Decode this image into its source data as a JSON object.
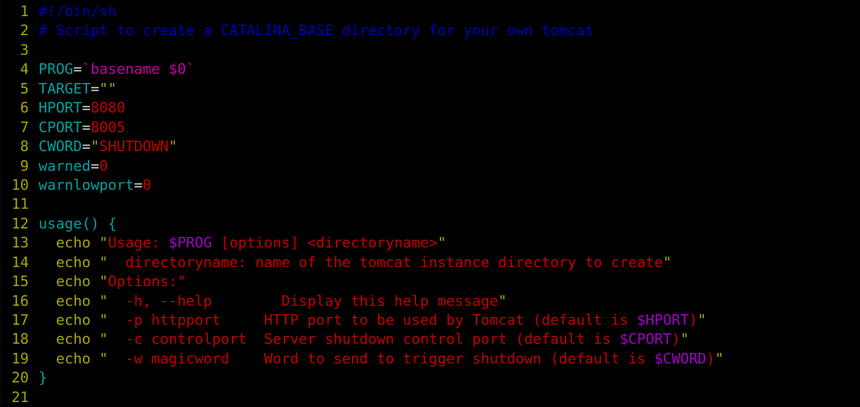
{
  "editor": {
    "title": "Shell Script Viewer",
    "language": "sh",
    "background_color": "#000000",
    "gutter_color": "#a6a600",
    "total_lines": 21,
    "colors": {
      "comment": "#0000b3",
      "variable": "#00a0a0",
      "operator": "#d8d8d8",
      "number": "#c00000",
      "string": "#c00000",
      "quote": "#a6a600",
      "keyword": "#a6a600",
      "substitution": "#a000c8",
      "backtick": "#c000a0",
      "brace": "#00a0a0"
    }
  },
  "lines": [
    {
      "num": "1",
      "tokens": [
        {
          "t": "#!/bin/sh",
          "c": "tok-comment"
        }
      ]
    },
    {
      "num": "2",
      "tokens": [
        {
          "t": "# Script to create a CATALINA_BASE directory for your own tomcat",
          "c": "tok-comment"
        }
      ]
    },
    {
      "num": "3",
      "tokens": []
    },
    {
      "num": "4",
      "tokens": [
        {
          "t": "PROG",
          "c": "tok-var"
        },
        {
          "t": "=",
          "c": "tok-op"
        },
        {
          "t": "`basename $0`",
          "c": "tok-backtick"
        }
      ]
    },
    {
      "num": "5",
      "tokens": [
        {
          "t": "TARGET",
          "c": "tok-var"
        },
        {
          "t": "=",
          "c": "tok-op"
        },
        {
          "t": "\"\"",
          "c": "tok-quote"
        }
      ]
    },
    {
      "num": "6",
      "tokens": [
        {
          "t": "HPORT",
          "c": "tok-var"
        },
        {
          "t": "=",
          "c": "tok-op"
        },
        {
          "t": "8080",
          "c": "tok-num"
        }
      ]
    },
    {
      "num": "7",
      "tokens": [
        {
          "t": "CPORT",
          "c": "tok-var"
        },
        {
          "t": "=",
          "c": "tok-op"
        },
        {
          "t": "8005",
          "c": "tok-num"
        }
      ]
    },
    {
      "num": "8",
      "tokens": [
        {
          "t": "CWORD",
          "c": "tok-var"
        },
        {
          "t": "=",
          "c": "tok-op"
        },
        {
          "t": "\"",
          "c": "tok-quote"
        },
        {
          "t": "SHUTDOWN",
          "c": "tok-str"
        },
        {
          "t": "\"",
          "c": "tok-quote"
        }
      ]
    },
    {
      "num": "9",
      "tokens": [
        {
          "t": "warned",
          "c": "tok-var"
        },
        {
          "t": "=",
          "c": "tok-op"
        },
        {
          "t": "0",
          "c": "tok-num"
        }
      ]
    },
    {
      "num": "10",
      "tokens": [
        {
          "t": "warnlowport",
          "c": "tok-var"
        },
        {
          "t": "=",
          "c": "tok-op"
        },
        {
          "t": "0",
          "c": "tok-num"
        }
      ]
    },
    {
      "num": "11",
      "tokens": []
    },
    {
      "num": "12",
      "tokens": [
        {
          "t": "usage",
          "c": "tok-var"
        },
        {
          "t": "() ",
          "c": "tok-brace"
        },
        {
          "t": "{",
          "c": "tok-brace"
        }
      ]
    },
    {
      "num": "13",
      "tokens": [
        {
          "t": "  ",
          "c": "tok-plain"
        },
        {
          "t": "echo",
          "c": "tok-kw"
        },
        {
          "t": " ",
          "c": "tok-plain"
        },
        {
          "t": "\"",
          "c": "tok-quote"
        },
        {
          "t": "Usage: ",
          "c": "tok-str"
        },
        {
          "t": "$PROG",
          "c": "tok-subst"
        },
        {
          "t": " [options] <directoryname>",
          "c": "tok-str"
        },
        {
          "t": "\"",
          "c": "tok-quote"
        }
      ]
    },
    {
      "num": "14",
      "tokens": [
        {
          "t": "  ",
          "c": "tok-plain"
        },
        {
          "t": "echo",
          "c": "tok-kw"
        },
        {
          "t": " ",
          "c": "tok-plain"
        },
        {
          "t": "\"",
          "c": "tok-quote"
        },
        {
          "t": "  directoryname: name of the tomcat instance directory to create",
          "c": "tok-str"
        },
        {
          "t": "\"",
          "c": "tok-quote"
        }
      ]
    },
    {
      "num": "15",
      "tokens": [
        {
          "t": "  ",
          "c": "tok-plain"
        },
        {
          "t": "echo",
          "c": "tok-kw"
        },
        {
          "t": " ",
          "c": "tok-plain"
        },
        {
          "t": "\"",
          "c": "tok-quote"
        },
        {
          "t": "Options:\"",
          "c": "tok-str"
        }
      ]
    },
    {
      "num": "16",
      "tokens": [
        {
          "t": "  ",
          "c": "tok-plain"
        },
        {
          "t": "echo",
          "c": "tok-kw"
        },
        {
          "t": " ",
          "c": "tok-plain"
        },
        {
          "t": "\"",
          "c": "tok-quote"
        },
        {
          "t": "  -h, --help        Display this help message",
          "c": "tok-str"
        },
        {
          "t": "\"",
          "c": "tok-quote"
        }
      ]
    },
    {
      "num": "17",
      "tokens": [
        {
          "t": "  ",
          "c": "tok-plain"
        },
        {
          "t": "echo",
          "c": "tok-kw"
        },
        {
          "t": " ",
          "c": "tok-plain"
        },
        {
          "t": "\"",
          "c": "tok-quote"
        },
        {
          "t": "  -p httpport     HTTP port to be used by Tomcat (default is ",
          "c": "tok-str"
        },
        {
          "t": "$HPORT",
          "c": "tok-subst"
        },
        {
          "t": ")",
          "c": "tok-str"
        },
        {
          "t": "\"",
          "c": "tok-quote"
        }
      ]
    },
    {
      "num": "18",
      "tokens": [
        {
          "t": "  ",
          "c": "tok-plain"
        },
        {
          "t": "echo",
          "c": "tok-kw"
        },
        {
          "t": " ",
          "c": "tok-plain"
        },
        {
          "t": "\"",
          "c": "tok-quote"
        },
        {
          "t": "  -c controlport  Server shutdown control port (default is ",
          "c": "tok-str"
        },
        {
          "t": "$CPORT",
          "c": "tok-subst"
        },
        {
          "t": ")",
          "c": "tok-str"
        },
        {
          "t": "\"",
          "c": "tok-quote"
        }
      ]
    },
    {
      "num": "19",
      "tokens": [
        {
          "t": "  ",
          "c": "tok-plain"
        },
        {
          "t": "echo",
          "c": "tok-kw"
        },
        {
          "t": " ",
          "c": "tok-plain"
        },
        {
          "t": "\"",
          "c": "tok-quote"
        },
        {
          "t": "  -w magicword    Word to send to trigger shutdown (default is ",
          "c": "tok-str"
        },
        {
          "t": "$CWORD",
          "c": "tok-subst"
        },
        {
          "t": ")",
          "c": "tok-str"
        },
        {
          "t": "\"",
          "c": "tok-quote"
        }
      ]
    },
    {
      "num": "20",
      "tokens": [
        {
          "t": "}",
          "c": "tok-brace"
        }
      ]
    },
    {
      "num": "21",
      "tokens": []
    }
  ]
}
